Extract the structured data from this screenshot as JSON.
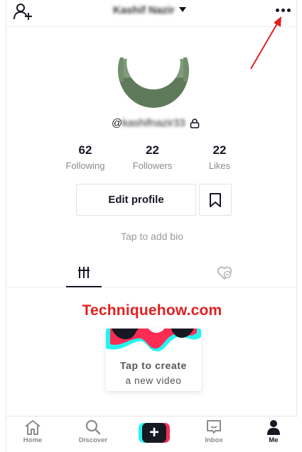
{
  "header": {
    "username": "Kashif Nazir",
    "more_icon": "more-horizontal-icon",
    "add_user_icon": "add-user-icon"
  },
  "profile": {
    "handle_prefix": "@",
    "handle_rest": "kashifnazir33",
    "stats": [
      {
        "value": "62",
        "label": "Following"
      },
      {
        "value": "22",
        "label": "Followers"
      },
      {
        "value": "22",
        "label": "Likes"
      }
    ],
    "edit_profile_label": "Edit profile",
    "bio_placeholder": "Tap to add bio"
  },
  "watermark": "Techniquehow.com",
  "empty_state": {
    "title": "Tap to create",
    "subtitle": "a new video"
  },
  "nav": [
    {
      "label": "Home",
      "icon": "home-icon"
    },
    {
      "label": "Discover",
      "icon": "search-icon"
    },
    {
      "label": "",
      "icon": "create-plus-icon"
    },
    {
      "label": "Inbox",
      "icon": "inbox-icon"
    },
    {
      "label": "Me",
      "icon": "person-icon"
    }
  ],
  "colors": {
    "accent_red": "#fe2c55",
    "accent_cyan": "#25f4ee",
    "annotation_red": "#e02020"
  }
}
